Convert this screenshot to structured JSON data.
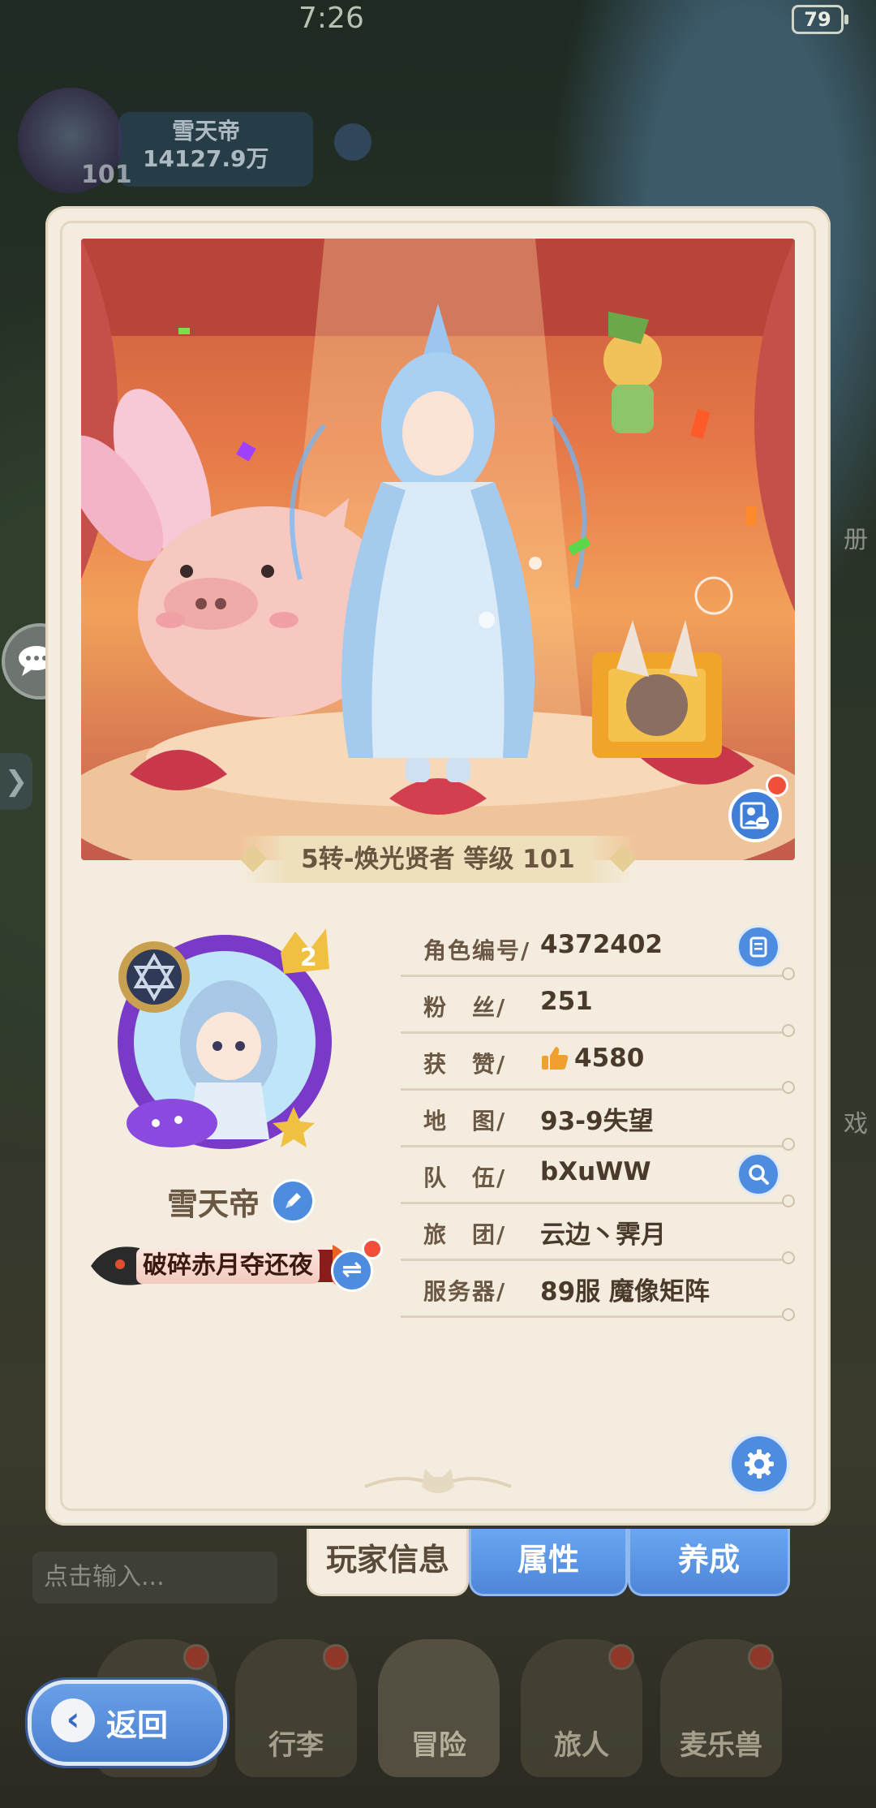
{
  "status": {
    "time": "7:26",
    "battery": "79"
  },
  "hud": {
    "name": "雪天帝",
    "power": "14127.9万",
    "level": "101"
  },
  "scene": {
    "class_line": "5转-焕光贤者 等级 101"
  },
  "player": {
    "name": "雪天帝",
    "title": "破碎赤月夺还夜"
  },
  "info": [
    {
      "label": "角色编号/",
      "value": "4372402",
      "button": "copy-icon"
    },
    {
      "label": "粉　丝/",
      "value": "251"
    },
    {
      "label": "获　赞/",
      "value": "4580",
      "icon": "thumbs-up-icon"
    },
    {
      "label": "地　图/",
      "value": "93-9失望"
    },
    {
      "label": "队　伍/",
      "value": "bXuWW",
      "button": "search-icon"
    },
    {
      "label": "旅　团/",
      "value": "云边丶霁月"
    },
    {
      "label": "服务器/",
      "value": "89服 魔像矩阵"
    }
  ],
  "tabs": {
    "active": "玩家信息",
    "attributes": "属性",
    "cultivate": "养成"
  },
  "chat": {
    "placeholder": "点击输入..."
  },
  "nav": {
    "bag": "行李",
    "adventure": "冒险",
    "travelers": "旅人",
    "pets": "麦乐兽",
    "back": "返回"
  },
  "side": {
    "right_a": "册",
    "right_b": "戏"
  },
  "colors": {
    "panel": "#f4eddf",
    "accent_blue": "#4e8ce0",
    "badge_red": "#f0503a"
  }
}
